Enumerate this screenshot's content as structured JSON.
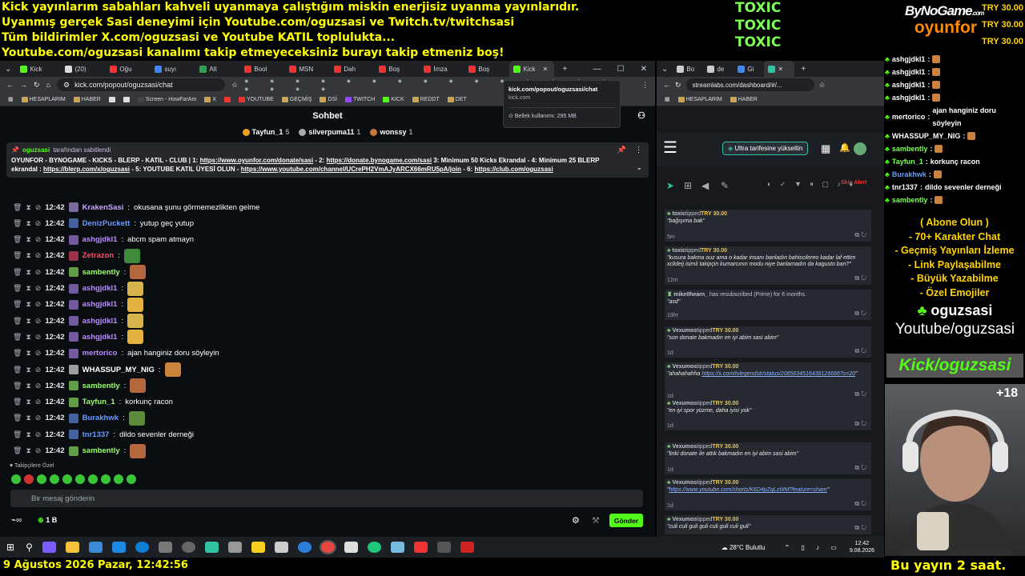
{
  "banner_lines": [
    "Kick yayınlarım sabahları kahveli uyanmaya çalıştığım miskin enerjisiz uyanma yayınlarıdır.",
    "Uyanmış gerçek Sasi deneyimi için Youtube.com/oguzsasi ve Twitch.tv/twitchsasi",
    "Tüm bildirimler X.com/oguzsasi ve Youtube KATIL toplulukta...",
    "Youtube.com/oguzsasi kanalımı takip etmeyeceksiniz burayı takip etmeniz boş!"
  ],
  "toxic": [
    "TOXIC",
    "TOXIC",
    "TOXIC"
  ],
  "brand": {
    "top": "ByNoGame",
    "domain": ".com",
    "bottom": "oyunfor"
  },
  "tries": [
    "TRY 30.00",
    "TRY 30.00",
    "TRY 30.00"
  ],
  "tabs": [
    "Kick",
    "(20)",
    "Oğu",
    "suyı",
    "Alt",
    "Bool",
    "MSN",
    "Dah",
    "Boş",
    "İmza",
    "Boş",
    "Kick"
  ],
  "url": "kick.com/popout/oguzsasi/chat",
  "bookmarks": [
    "HESAPLARIM",
    "HABER",
    "",
    "",
    "Screen - HowFarAm",
    "X",
    "",
    "YOUTUBE",
    "GEÇMİŞ",
    "DSİ",
    "TWITCH",
    "KICK",
    "REDDT",
    "DET"
  ],
  "tooltip": {
    "url": "kick.com/popout/oguzsasi/chat",
    "domain": "kick.com",
    "memory": "Bellek kullanımı: 295 MB"
  },
  "chat_title": "Sohbet",
  "gifters": [
    {
      "name": "Tayfun_1",
      "count": "5"
    },
    {
      "name": "silverpuma11",
      "count": "1"
    },
    {
      "name": "wonssy",
      "count": "1"
    }
  ],
  "pinned": {
    "by": "oguzsasi",
    "by_suffix": "tarafından sabitlendi",
    "text1": "OYUNFOR - BYNOGAME - KICKS - BLERP - KATIL - CLUB | 1: ",
    "link1": "https://www.oyunfor.com/donate/sasi",
    "text2": " - 2: ",
    "link2": "https://donate.bynogame.com/sasi",
    "text3": " 3: Minimum 50 Kicks Ekrandal - 4: Minimum 25 BLERP ekrandal : ",
    "link3": "https://blerp.com/x/oguzsasi",
    "text4": " - 5: YOUTUBE KATIL ÜYESİ OLUN - ",
    "link4": "https://www.youtube.com/channel/UCrePH2VmAJyARCX66mRU5pA/join",
    "text5": " - 6: ",
    "link5": "https://club.com/oguzsasi"
  },
  "messages": [
    {
      "time": "12:42",
      "user": "KrakenSasi",
      "color": "#c7a7ff",
      "text": "okusana şunu görmemezlikten gelme",
      "emote": ""
    },
    {
      "time": "12:42",
      "user": "DenizPuckett",
      "color": "#6b9bff",
      "text": "yutup geç yutup",
      "emote": ""
    },
    {
      "time": "12:42",
      "user": "ashgjdkl1",
      "color": "#b98cff",
      "text": "abcm spam atmayn",
      "emote": ""
    },
    {
      "time": "12:42",
      "user": "Zetrazon",
      "color": "#ff4d6a",
      "text": "",
      "emote": "#3f8a3a"
    },
    {
      "time": "12:42",
      "user": "sambently",
      "color": "#9dff6a",
      "text": "",
      "emote": "#b4663c"
    },
    {
      "time": "12:42",
      "user": "ashgjdkl1",
      "color": "#b98cff",
      "text": "",
      "emote": "#d8b54a"
    },
    {
      "time": "12:42",
      "user": "ashgjdkl1",
      "color": "#b98cff",
      "text": "",
      "emote": "#e3b340"
    },
    {
      "time": "12:42",
      "user": "ashgjdkl1",
      "color": "#b98cff",
      "text": "",
      "emote": "#d8b54a"
    },
    {
      "time": "12:42",
      "user": "ashgjdkl1",
      "color": "#b98cff",
      "text": "",
      "emote": "#e3b340"
    },
    {
      "time": "12:42",
      "user": "mertorico",
      "color": "#b98cff",
      "text": "ajan hanginiz doru söyleyin",
      "emote": ""
    },
    {
      "time": "12:42",
      "user": "WHASSUP_MY_NIG",
      "color": "#ffffff",
      "text": "",
      "emote": "#c9833a"
    },
    {
      "time": "12:42",
      "user": "sambently",
      "color": "#9dff6a",
      "text": "",
      "emote": "#b4663c"
    },
    {
      "time": "12:42",
      "user": "Tayfun_1",
      "color": "#9dff6a",
      "text": "korkunç racon",
      "emote": ""
    },
    {
      "time": "12:42",
      "user": "Burakhwk",
      "color": "#6b9bff",
      "text": "",
      "emote": "#5a8a3a"
    },
    {
      "time": "12:42",
      "user": "tnr1337",
      "color": "#6b9bff",
      "text": "dildo sevenler derneği",
      "emote": ""
    },
    {
      "time": "12:42",
      "user": "sambently",
      "color": "#9dff6a",
      "text": "",
      "emote": "#b4663c"
    }
  ],
  "subs_label": "Takipçilere Özel",
  "input_placeholder": "Bir mesaj gönderin",
  "kicks_count": "1 B",
  "send_label": "Gönder",
  "streamlabs": {
    "url": "streamlabs.com/dashboard/#/...",
    "bookmarks": [
      "HESAPLARIM",
      "HABER"
    ],
    "upgrade": "Ultra tarifesine yükseltin",
    "skip": "Skip Alert"
  },
  "events": [
    {
      "user": "toxic",
      "action": "tipped",
      "amount": "TRY 30.00",
      "quote": "\"bağışıma bak\"",
      "time": "5m",
      "link": ""
    },
    {
      "user": "toxic",
      "action": "tipped",
      "amount": "TRY 30.00",
      "quote": "\"kusura bakma ouz ama o kadar insanı banladın bahiscilereo kadar laf ettim xclideij isimli takipçin kumarcının modu niye banlamadın da kagusto ban?\"",
      "time": "12m",
      "link": ""
    },
    {
      "user": "mike0hearn_",
      "action": " has resubscribed (Prime) for 6 months.",
      "amount": "",
      "quote": "\"asd\"",
      "time": "19hr",
      "link": ""
    },
    {
      "user": "Vexumos",
      "action": "tipped",
      "amount": "TRY 30.00",
      "quote": "\"son donate bakmadın en iyi abim sasi abim\"",
      "time": "1d",
      "link": ""
    },
    {
      "user": "Vexumos",
      "action": "tipped",
      "amount": "TRY 30.00",
      "quote": "\"ahahahahha ",
      "time": "1d",
      "link": "https://x.com/tvlegendstr/status/2085634516438126666?s=20"
    },
    {
      "user": "Vexumos",
      "action": "tipped",
      "amount": "TRY 30.00",
      "quote": "\"en iyi spor yüzme, daha iyisi yok\"",
      "time": "1d",
      "link": ""
    },
    {
      "user": "Vexumos",
      "action": "tipped",
      "amount": "TRY 30.00",
      "quote": "\"linki donate ile attık bakmadın en iyi abim sasi abim\"",
      "time": "1d",
      "link": ""
    },
    {
      "user": "Vexumos",
      "action": "tipped",
      "amount": "TRY 30.00",
      "quote": "\"",
      "time": "1d",
      "link": "https://www.youtube.com/shorts/K6D4pZqLzWM?feature=share"
    },
    {
      "user": "Vexumos",
      "action": "tipped",
      "amount": "TRY 30.00",
      "quote": "\"culi culi guli guli culi guli culi guli\"",
      "time": "",
      "link": ""
    }
  ],
  "rchat": [
    {
      "user": "ashgjdkl1",
      "color": "#ffffff",
      "text": ""
    },
    {
      "user": "ashgjdkl1",
      "color": "#ffffff",
      "text": ""
    },
    {
      "user": "ashgjdkl1",
      "color": "#ffffff",
      "text": ""
    },
    {
      "user": "ashgjdkl1",
      "color": "#ffffff",
      "text": ""
    },
    {
      "user": "mertorico",
      "color": "#ffffff",
      "text": "ajan hanginiz doru söyleyin"
    },
    {
      "user": "WHASSUP_MY_NIG",
      "color": "#ffffff",
      "text": ""
    },
    {
      "user": "sambently",
      "color": "#7dff57",
      "text": ""
    },
    {
      "user": "Tayfun_1",
      "color": "#7dff57",
      "text": "korkunç racon"
    },
    {
      "user": "Burakhwk",
      "color": "#6b9bff",
      "text": ""
    },
    {
      "user": "tnr1337",
      "color": "#ffffff",
      "text": "dildo sevenler derneği"
    },
    {
      "user": "sambently",
      "color": "#7dff57",
      "text": ""
    }
  ],
  "promo": [
    "( Abone Olun )",
    "- 70+ Karakter Chat",
    "- Geçmiş Yayınları İzleme",
    "- Link Paylaşabilme",
    "- Büyük Yazabilme",
    "- Özel Emojiler"
  ],
  "kick_handle": "oguzsasi",
  "youtube_handle": "Youtube/oguzsasi",
  "kick_bar": "Kick/oguzsasi",
  "age": "+18",
  "weather": "28°C Bulutlu",
  "clock_time": "12:42",
  "clock_date": "9.08.2026",
  "bottom_datetime": "9 Ağustos 2026 Pazar, 12:42:56",
  "bottom_right": "Bu yayın 2 saat."
}
